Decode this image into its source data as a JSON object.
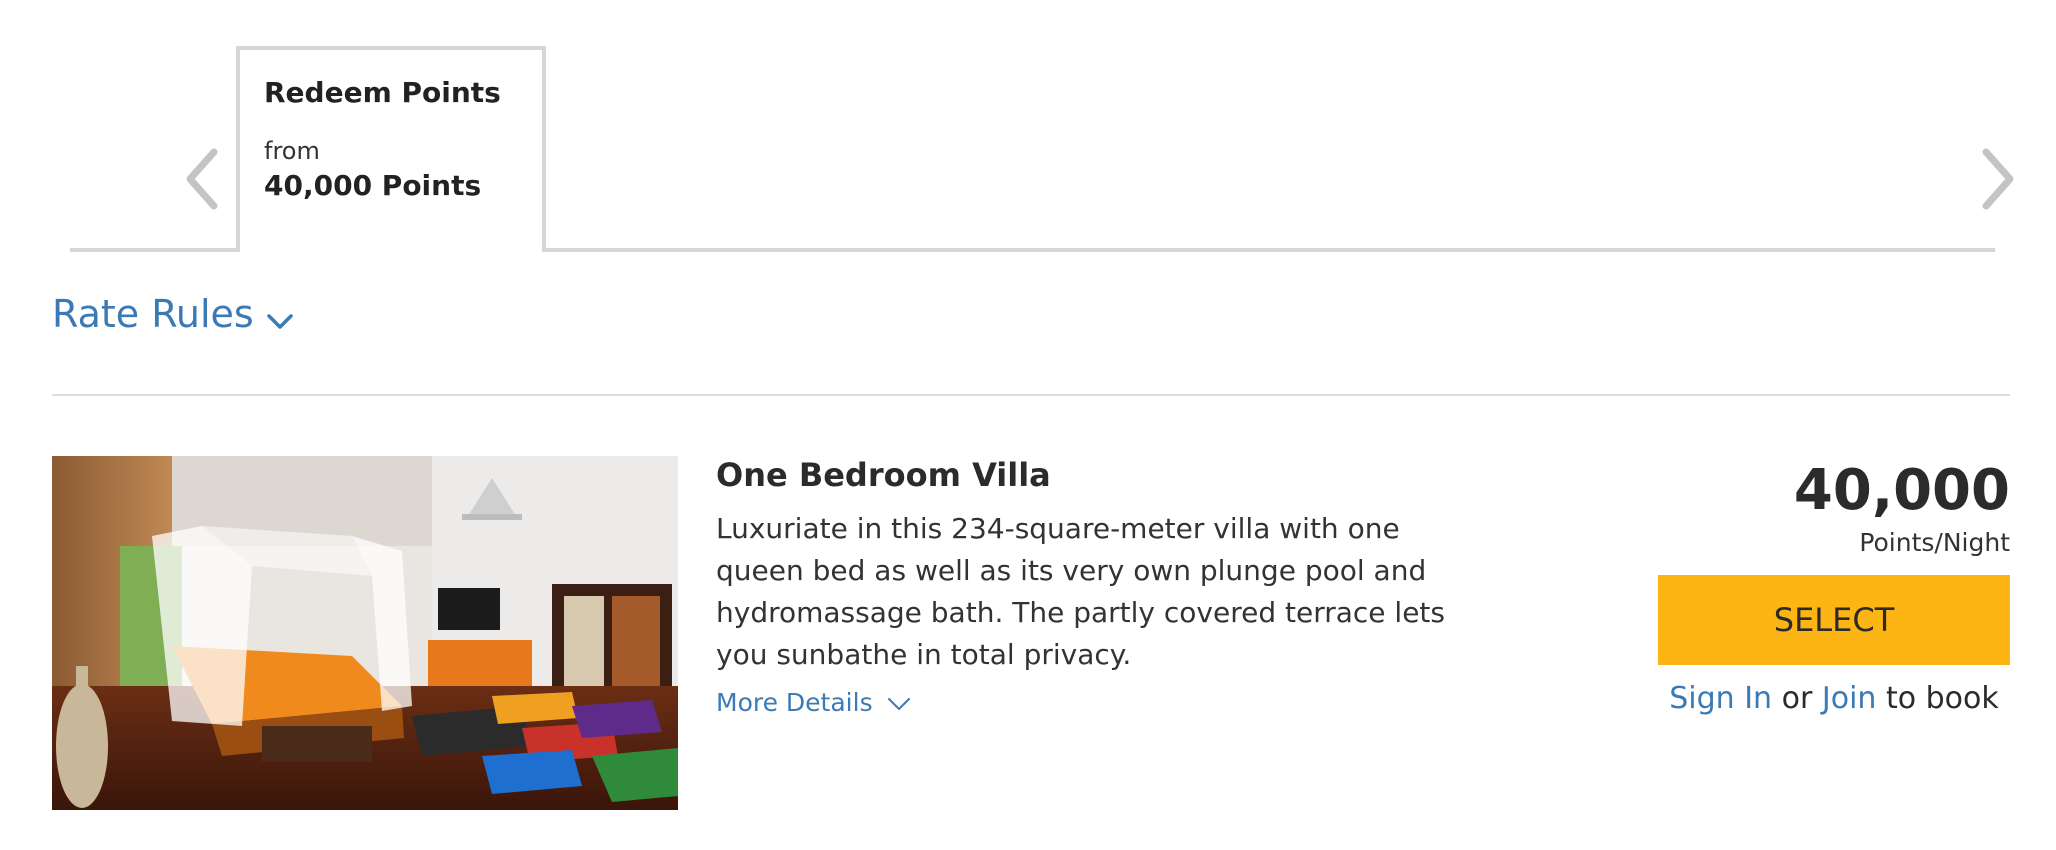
{
  "rate_tabs": {
    "active": {
      "title": "Redeem Points",
      "from_label": "from",
      "amount": "40,000 Points"
    }
  },
  "rate_rules": {
    "label": "Rate Rules"
  },
  "room": {
    "name": "One Bedroom Villa",
    "description": "Luxuriate in this 234-square-meter villa with one queen bed as well as its very own plunge pool and hydromassage bath. The partly covered terrace lets you sunbathe in total privacy.",
    "more_details": "More Details",
    "price": "40,000",
    "price_unit": "Points/Night",
    "select_label": "SELECT",
    "sign_in": "Sign In",
    "or": "or",
    "join": "Join",
    "to_book": "to book"
  },
  "colors": {
    "link": "#3b7ab5",
    "select_button": "#fdb515",
    "tab_border": "#d6d6d6"
  },
  "icons": [
    "chevron-left-icon",
    "chevron-right-icon",
    "chevron-down-icon"
  ]
}
